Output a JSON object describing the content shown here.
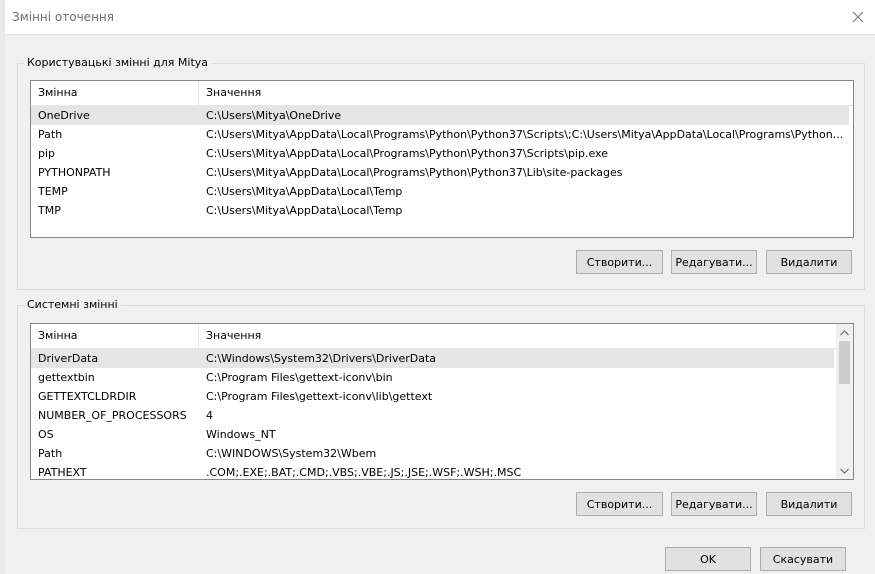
{
  "window": {
    "title": "Змінні оточення"
  },
  "user_vars": {
    "group_label": "Користувацькі змінні для Mitya",
    "columns": [
      "Змінна",
      "Значення"
    ],
    "rows": [
      {
        "name": "OneDrive",
        "value": "C:\\Users\\Mitya\\OneDrive",
        "selected": true
      },
      {
        "name": "Path",
        "value": "C:\\Users\\Mitya\\AppData\\Local\\Programs\\Python\\Python37\\Scripts\\;C:\\Users\\Mitya\\AppData\\Local\\Programs\\Python..."
      },
      {
        "name": "pip",
        "value": "C:\\Users\\Mitya\\AppData\\Local\\Programs\\Python\\Python37\\Scripts\\pip.exe"
      },
      {
        "name": "PYTHONPATH",
        "value": "C:\\Users\\Mitya\\AppData\\Local\\Programs\\Python\\Python37\\Lib\\site-packages"
      },
      {
        "name": "TEMP",
        "value": "C:\\Users\\Mitya\\AppData\\Local\\Temp"
      },
      {
        "name": "TMP",
        "value": "C:\\Users\\Mitya\\AppData\\Local\\Temp"
      }
    ],
    "buttons": {
      "new": "Створити...",
      "edit": "Редагувати...",
      "delete": "Видалити"
    }
  },
  "system_vars": {
    "group_label": "Системні змінні",
    "columns": [
      "Змінна",
      "Значення"
    ],
    "rows": [
      {
        "name": "DriverData",
        "value": "C:\\Windows\\System32\\Drivers\\DriverData",
        "selected": true
      },
      {
        "name": "gettextbin",
        "value": "C:\\Program Files\\gettext-iconv\\bin"
      },
      {
        "name": "GETTEXTCLDRDIR",
        "value": "C:\\Program Files\\gettext-iconv\\lib\\gettext"
      },
      {
        "name": "NUMBER_OF_PROCESSORS",
        "value": "4"
      },
      {
        "name": "OS",
        "value": "Windows_NT"
      },
      {
        "name": "Path",
        "value": "C:\\WINDOWS\\System32\\Wbem"
      },
      {
        "name": "PATHEXT",
        "value": ".COM;.EXE;.BAT;.CMD;.VBS;.VBE;.JS;.JSE;.WSF;.WSH;.MSC"
      }
    ],
    "buttons": {
      "new": "Створити...",
      "edit": "Редагувати...",
      "delete": "Видалити"
    }
  },
  "footer": {
    "ok": "OK",
    "cancel": "Скасувати"
  }
}
